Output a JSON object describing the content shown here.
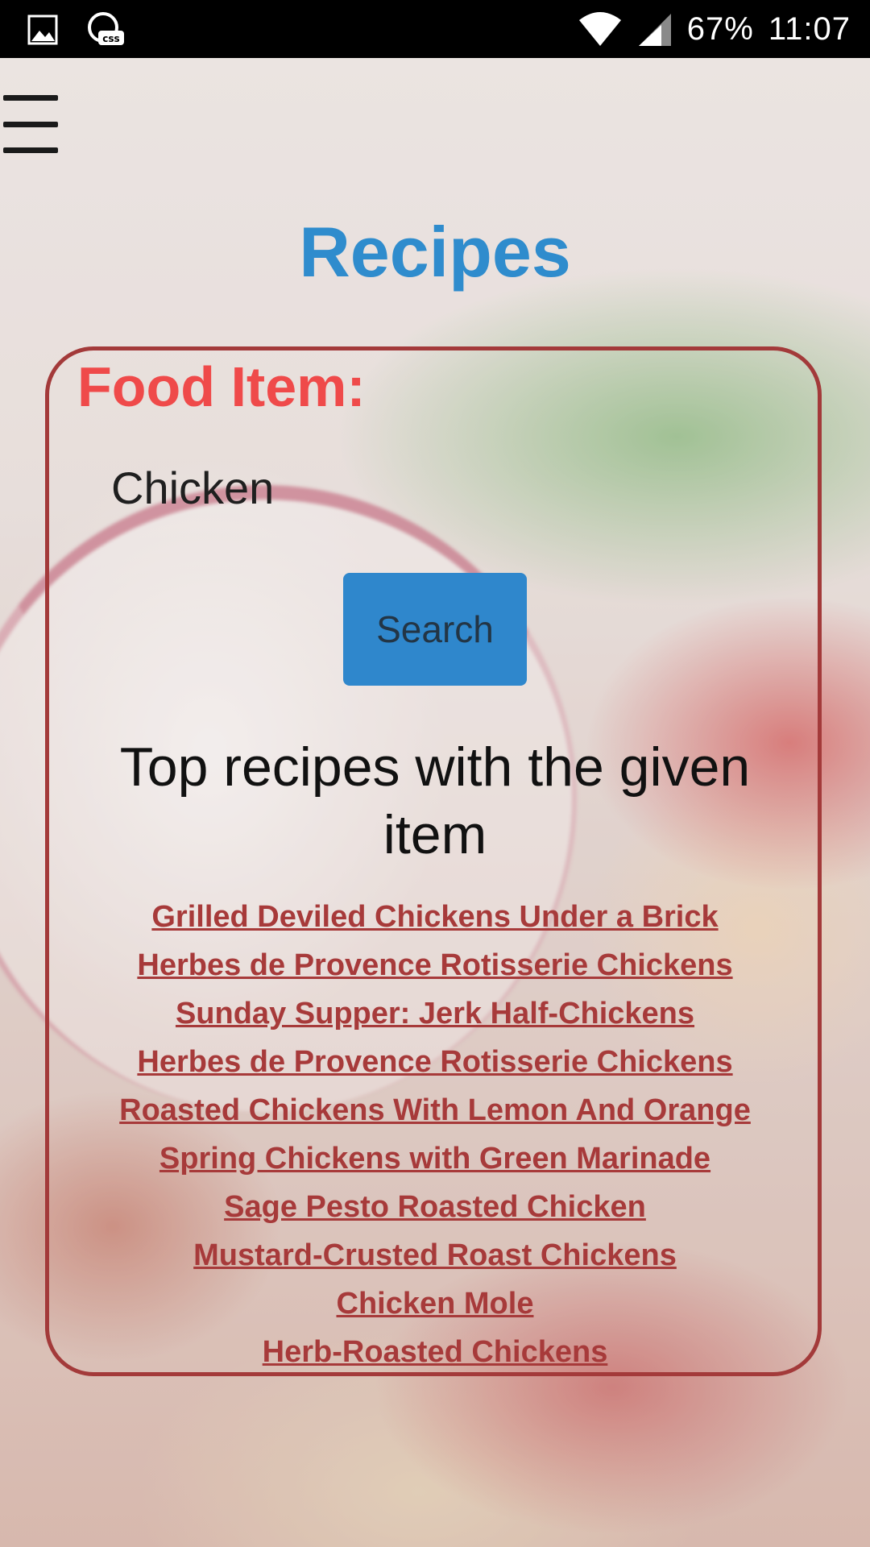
{
  "status_bar": {
    "battery": "67%",
    "time": "11:07",
    "left_icons": [
      "image-icon",
      "css-app-icon"
    ],
    "right_icons": [
      "wifi-icon",
      "signal-icon"
    ]
  },
  "header": {
    "menu_icon": "hamburger-menu-icon",
    "title": "Recipes"
  },
  "form": {
    "label": "Food Item:",
    "input_value": "Chicken",
    "search_label": "Search"
  },
  "results": {
    "heading": "Top recipes with the given item",
    "items": [
      "Grilled Deviled Chickens Under a Brick",
      "Herbes de Provence Rotisserie Chickens",
      "Sunday Supper: Jerk Half-Chickens",
      "Herbes de Provence Rotisserie Chickens",
      "Roasted Chickens With Lemon And Orange",
      "Spring Chickens with Green Marinade",
      "Sage Pesto Roasted Chicken",
      "Mustard-Crusted Roast Chickens",
      "Chicken Mole",
      "Herb-Roasted Chickens"
    ]
  },
  "colors": {
    "title": "#2f8ccd",
    "label": "#ef4a4a",
    "button": "#2f87cc",
    "link": "#a73a3a",
    "card_border": "#a33a3a"
  }
}
